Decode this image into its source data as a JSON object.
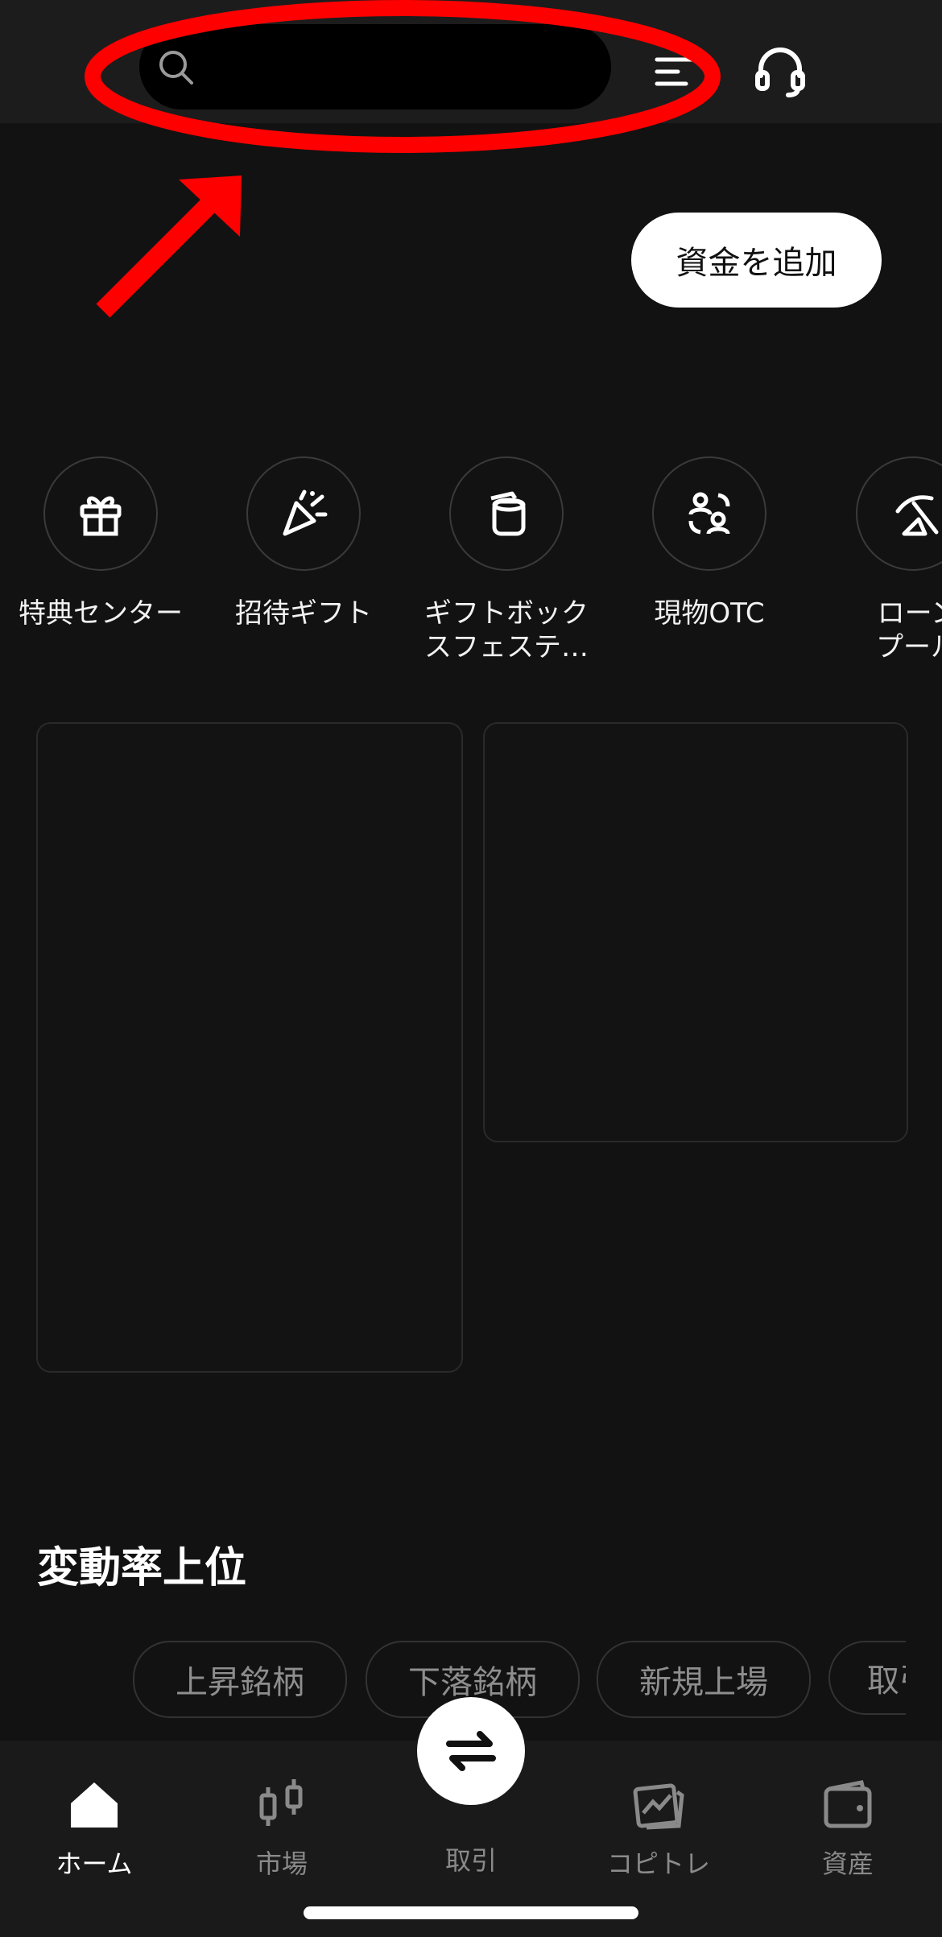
{
  "header": {
    "search_placeholder": "",
    "icons": [
      "search-icon",
      "filter-icon",
      "headset-icon"
    ]
  },
  "actions": {
    "add_funds": "資金を追加"
  },
  "shortcuts": [
    {
      "label": "特典センター",
      "icon": "gift-icon"
    },
    {
      "label": "招待ギフト",
      "icon": "party-popper-icon"
    },
    {
      "label": "ギフトボック\nスフェステ…",
      "icon": "gift-box-icon"
    },
    {
      "label": "現物OTC",
      "icon": "users-exchange-icon"
    },
    {
      "label": "ローン\nプール",
      "icon": "pickaxe-icon"
    }
  ],
  "movers": {
    "title": "変動率上位",
    "filters": [
      "上昇銘柄",
      "下落銘柄",
      "新規上場",
      "取引"
    ]
  },
  "bottom_nav": {
    "items": [
      {
        "label": "ホーム",
        "icon": "home-icon",
        "active": true
      },
      {
        "label": "市場",
        "icon": "candlestick-icon",
        "active": false
      },
      {
        "label": "取引",
        "icon": "swap-icon",
        "active": false
      },
      {
        "label": "コピトレ",
        "icon": "copy-trade-icon",
        "active": false
      },
      {
        "label": "資産",
        "icon": "wallet-icon",
        "active": false
      }
    ]
  },
  "colors": {
    "background": "#121212",
    "header_bg": "#1c1c1c",
    "annotation": "#ff0000",
    "inactive_text": "#8a8a8a"
  }
}
